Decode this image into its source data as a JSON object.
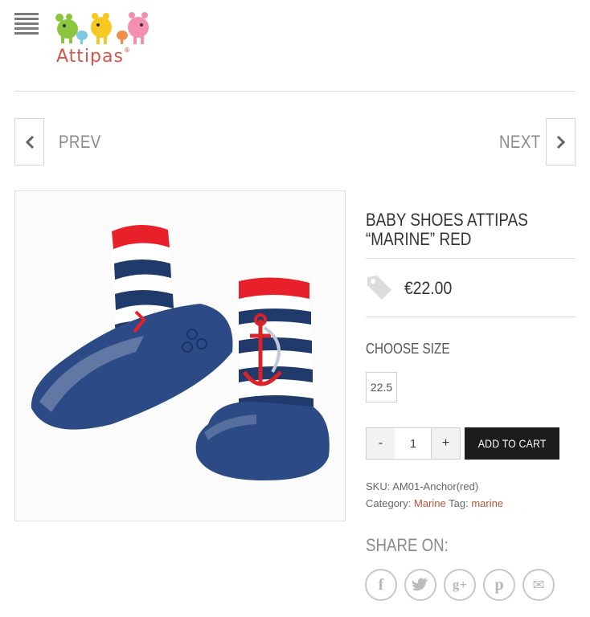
{
  "header": {
    "logo_text": "Attipas",
    "logo_mark": "®"
  },
  "nav": {
    "prev_label": "PREV",
    "next_label": "NEXT"
  },
  "product": {
    "title": "BABY SHOES ATTIPAS “MARINE” RED",
    "price": "€22.00",
    "size_label": "CHOOSE SIZE",
    "sizes": [
      "22.5"
    ],
    "quantity": "1",
    "qty_minus": "-",
    "qty_plus": "+",
    "add_to_cart": "ADD TO CART",
    "sku_label": "SKU:",
    "sku_value": "AM01-Anchor(red)",
    "category_label": "Category:",
    "category_value": "Marine",
    "tag_label": "Tag:",
    "tag_value": "marine"
  },
  "share": {
    "label": "SHARE ON:",
    "buttons": [
      {
        "icon": "facebook-icon",
        "glyph": "f"
      },
      {
        "icon": "twitter-icon",
        "glyph": "t"
      },
      {
        "icon": "google-plus-icon",
        "glyph": "g+"
      },
      {
        "icon": "pinterest-icon",
        "glyph": "p"
      },
      {
        "icon": "email-icon",
        "glyph": "✉"
      }
    ]
  },
  "colors": {
    "accent_link": "#b5553a",
    "cart_button": "#1c1c1c",
    "logo_text": "#d3554a"
  }
}
